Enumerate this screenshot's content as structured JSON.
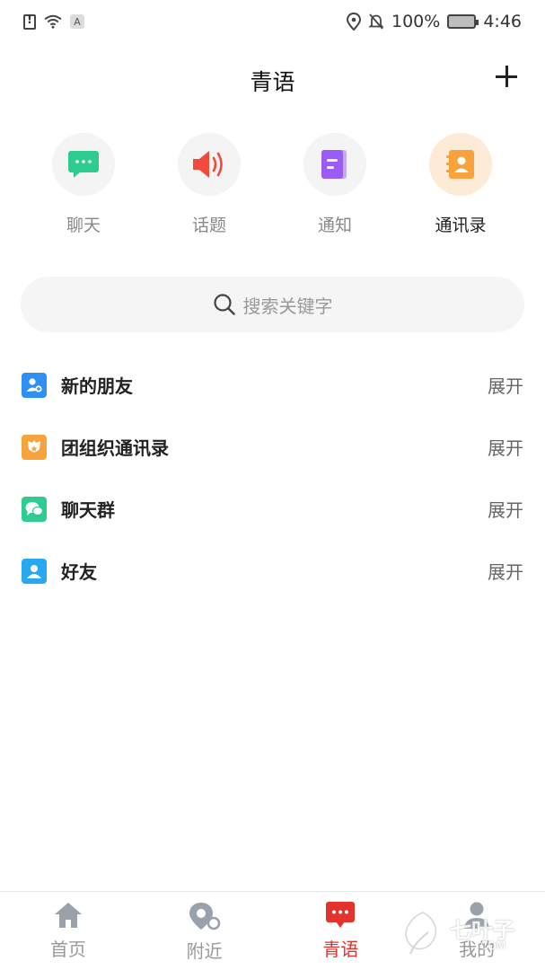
{
  "status_bar": {
    "battery_percent": "100%",
    "time": "4:46",
    "sim_badge": "A"
  },
  "header": {
    "title": "青语"
  },
  "quick_tabs": [
    {
      "label": "聊天",
      "icon": "chat-bubble-icon",
      "color": "#2ecc8e",
      "active": false
    },
    {
      "label": "话题",
      "icon": "speaker-icon",
      "color": "#f04b3c",
      "active": false
    },
    {
      "label": "通知",
      "icon": "notice-icon",
      "color": "#9b5cf6",
      "active": false
    },
    {
      "label": "通讯录",
      "icon": "contacts-book-icon",
      "color": "#f7a23b",
      "active": true
    }
  ],
  "search": {
    "placeholder": "搜索关键字"
  },
  "groups": [
    {
      "label": "新的朋友",
      "action": "展开",
      "icon": "new-friend-icon",
      "color": "#2f8ff2"
    },
    {
      "label": "团组织通讯录",
      "action": "展开",
      "icon": "league-directory-icon",
      "color": "#f7a23b"
    },
    {
      "label": "聊天群",
      "action": "展开",
      "icon": "group-chat-icon",
      "color": "#2ecc8e"
    },
    {
      "label": "好友",
      "action": "展开",
      "icon": "friend-icon",
      "color": "#29a8f2"
    }
  ],
  "bottom_nav": [
    {
      "label": "首页",
      "icon": "home-icon",
      "active": false
    },
    {
      "label": "附近",
      "icon": "nearby-icon",
      "active": false
    },
    {
      "label": "青语",
      "icon": "message-icon",
      "active": true
    },
    {
      "label": "我的",
      "icon": "profile-icon",
      "active": false
    }
  ],
  "colors": {
    "accent": "#e5322d",
    "inactive": "#999999"
  },
  "watermark": {
    "text": "七叶子",
    "sub": "COM"
  }
}
